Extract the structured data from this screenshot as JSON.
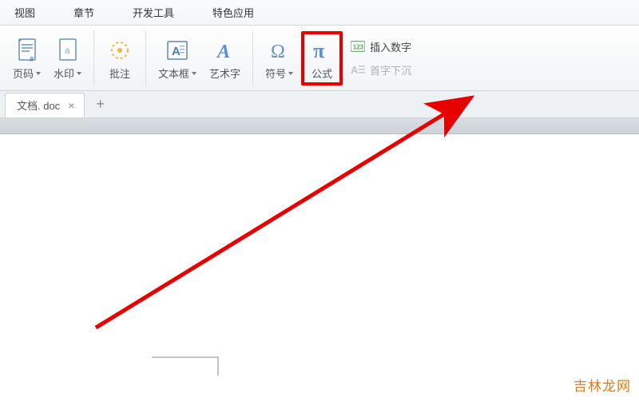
{
  "menu": {
    "items": [
      "视图",
      "章节",
      "开发工具",
      "特色应用"
    ]
  },
  "ribbon": {
    "pageNumber": "页码",
    "watermark": "水印",
    "comment": "批注",
    "textBox": "文本框",
    "wordArt": "艺术字",
    "symbol": "符号",
    "formula": "公式"
  },
  "rightPanel": {
    "insertNumber": "插入数字",
    "dropCap": "首字下沉"
  },
  "tab": {
    "label": "文档. doc"
  },
  "watermark": "吉林龙网"
}
